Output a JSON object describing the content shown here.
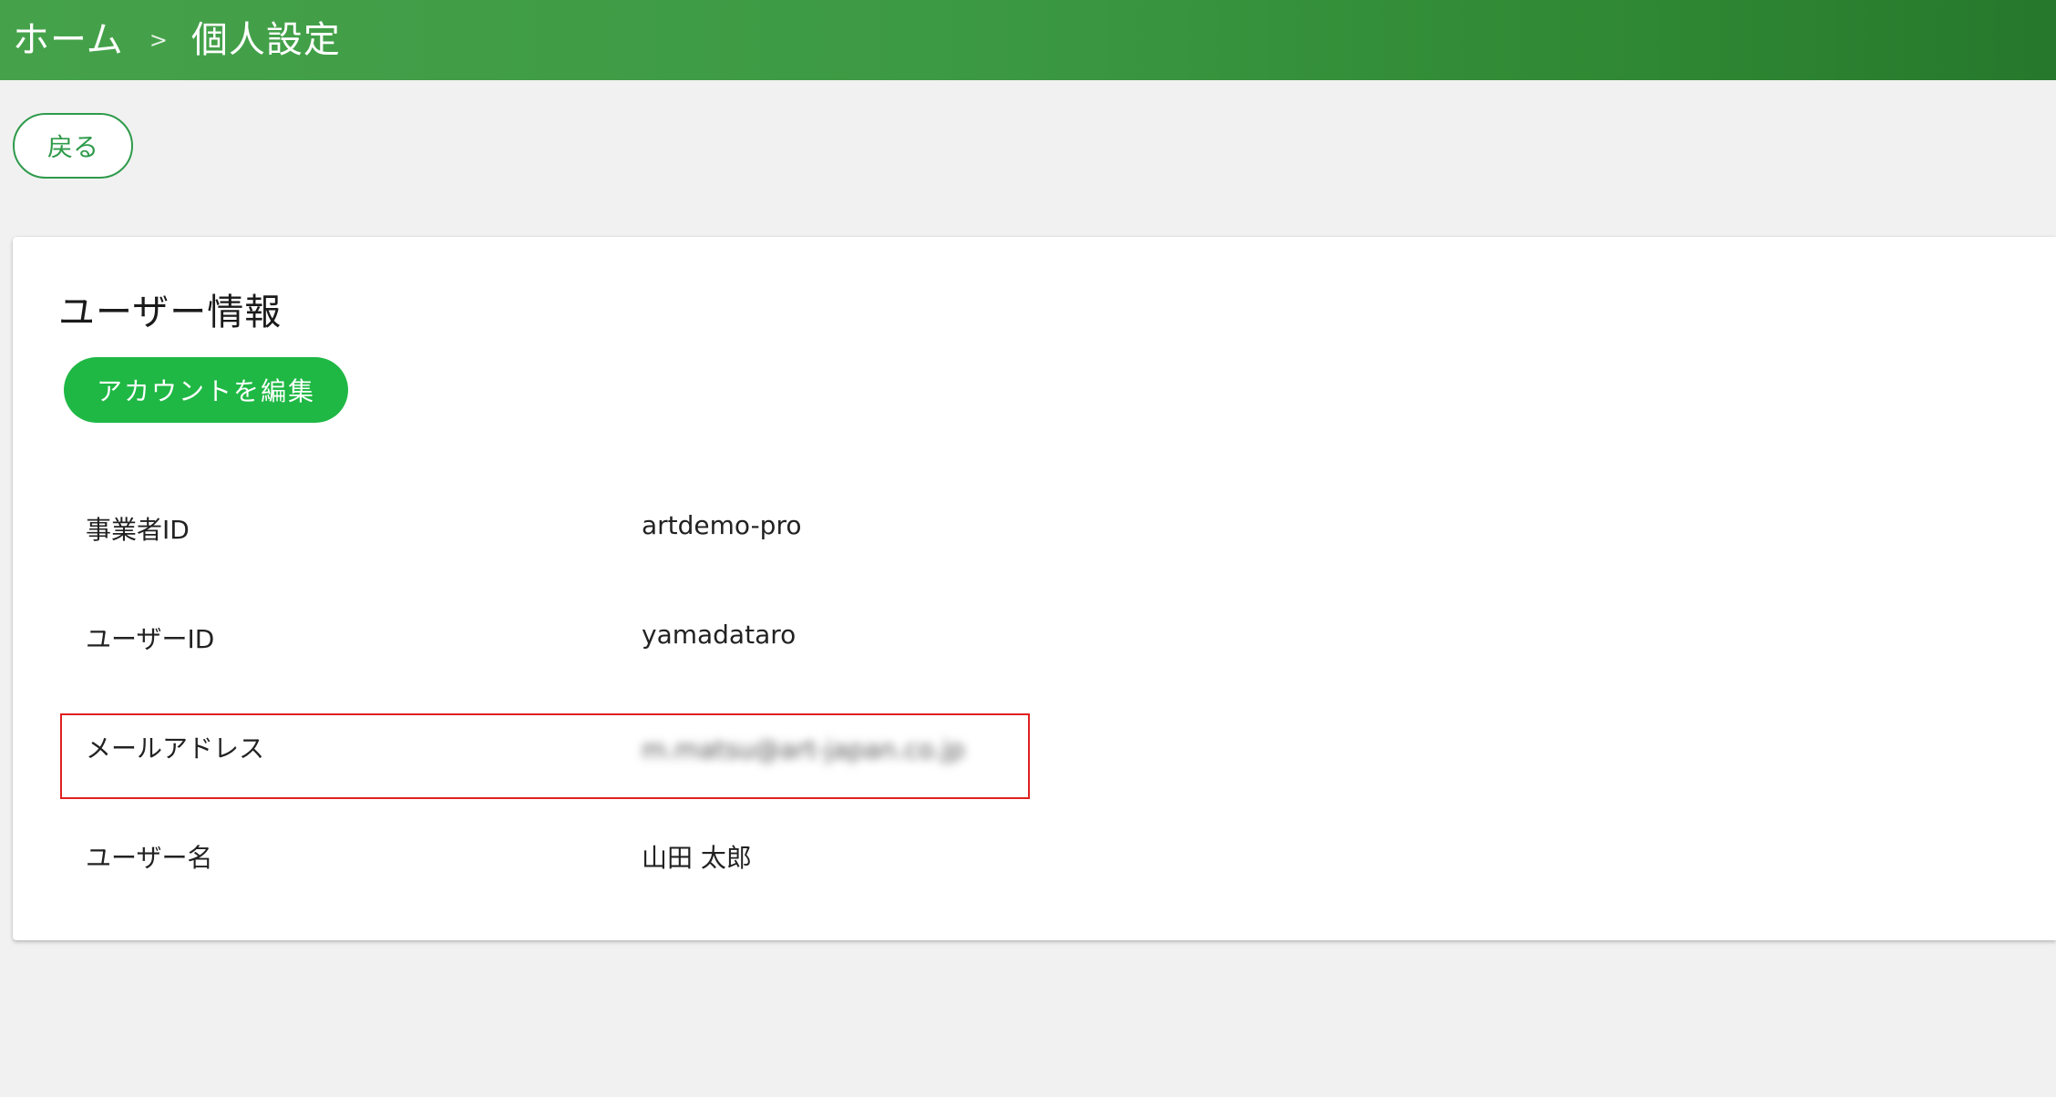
{
  "header": {
    "home": "ホーム",
    "separator": ">",
    "current": "個人設定"
  },
  "back_button": {
    "label": "戻る"
  },
  "card": {
    "title": "ユーザー情報",
    "edit_button": "アカウントを編集",
    "rows": [
      {
        "label": "事業者ID",
        "value": "artdemo-pro"
      },
      {
        "label": "ユーザーID",
        "value": "yamadataro"
      },
      {
        "label": "メールアドレス",
        "value": "m.matsu@art-japan.co.jp"
      },
      {
        "label": "ユーザー名",
        "value": "山田 太郎"
      }
    ]
  },
  "colors": {
    "header_start": "#45a24a",
    "header_end": "#26782c",
    "primary_button": "#1fb845",
    "outline_button": "#2e9a4a",
    "highlight": "#e02020"
  }
}
